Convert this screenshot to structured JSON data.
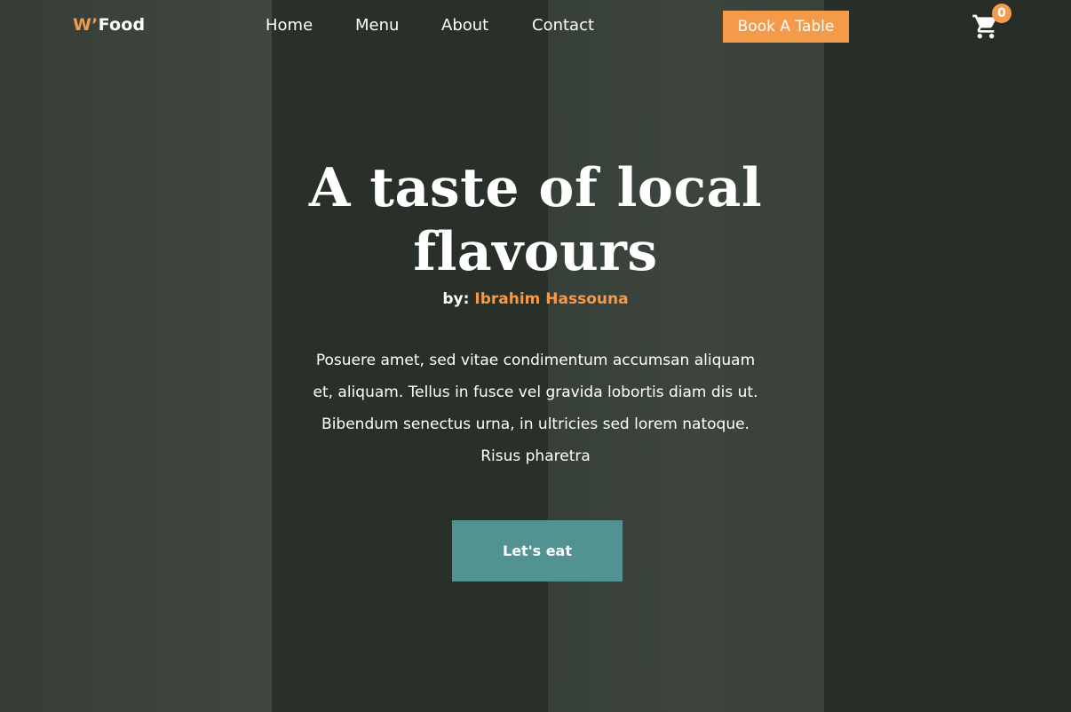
{
  "brand": {
    "logo_mark": "W’",
    "logo_word": "Food",
    "accent_color": "#f39a4b"
  },
  "nav": {
    "items": [
      {
        "label": "Home"
      },
      {
        "label": "Menu"
      },
      {
        "label": "About"
      },
      {
        "label": "Contact"
      }
    ],
    "book_label": "Book A Table",
    "cart_icon": "shopping-cart-icon",
    "cart_count": "0"
  },
  "hero": {
    "title_line1": "A taste of local",
    "title_line2": "flavours",
    "by_prefix": "by:",
    "author": "Ibrahim Hassouna",
    "description_lines": [
      "Posuere amet, sed vitae condimentum accumsan aliquam",
      "et, aliquam. Tellus in fusce vel gravida lobortis diam dis ut.",
      "Bibendum senectus urna, in ultricies sed lorem natoque.",
      "Risus pharetra"
    ],
    "cta_label": "Let's eat",
    "cta_color": "#529392"
  }
}
